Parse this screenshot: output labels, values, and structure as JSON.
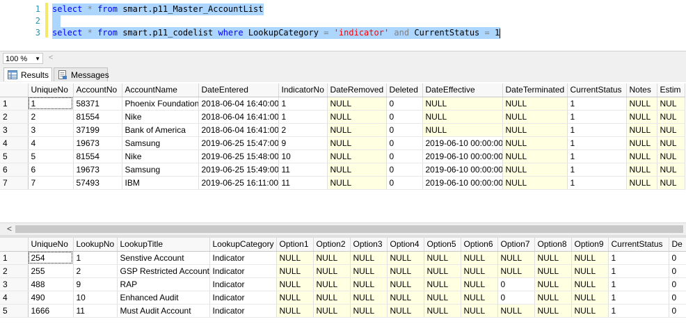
{
  "editor": {
    "lines": [
      {
        "num": "1"
      },
      {
        "num": "2"
      },
      {
        "num": "3"
      }
    ],
    "line1": {
      "kw1": "select",
      "star": "*",
      "kw2": "from",
      "obj": "smart.p11_Master_AccountList"
    },
    "line3": {
      "kw1": "select",
      "star": "*",
      "kw2": "from",
      "obj": "smart.p11_codelist",
      "kw3": "where",
      "col1": "LookupCategory",
      "op1": "=",
      "str": "'indicator'",
      "and": "and",
      "col2": "CurrentStatus",
      "op2": "=",
      "num": "1"
    }
  },
  "zoom": {
    "value": "100 %",
    "scroll_left": "<"
  },
  "tabs": [
    {
      "label": "Results",
      "icon": "grid-icon"
    },
    {
      "label": "Messages",
      "icon": "messages-icon"
    }
  ],
  "grid1": {
    "columns": [
      "",
      "UniqueNo",
      "AccountNo",
      "AccountName",
      "DateEntered",
      "IndicatorNo",
      "DateRemoved",
      "Deleted",
      "DateEffective",
      "DateTerminated",
      "CurrentStatus",
      "Notes",
      "Estim"
    ],
    "rows": [
      [
        "1",
        "1",
        "58371",
        "Phoenix Foundation",
        "2018-06-04 16:40:00",
        "1",
        "NULL",
        "0",
        "NULL",
        "NULL",
        "1",
        "NULL",
        "NUL"
      ],
      [
        "2",
        "2",
        "81554",
        "Nike",
        "2018-06-04 16:41:00",
        "1",
        "NULL",
        "0",
        "NULL",
        "NULL",
        "1",
        "NULL",
        "NUL"
      ],
      [
        "3",
        "3",
        "37199",
        "Bank of America",
        "2018-06-04 16:41:00",
        "2",
        "NULL",
        "0",
        "NULL",
        "NULL",
        "1",
        "NULL",
        "NUL"
      ],
      [
        "4",
        "4",
        "19673",
        "Samsung",
        "2019-06-25 15:47:00",
        "9",
        "NULL",
        "0",
        "2019-06-10 00:00:00",
        "NULL",
        "1",
        "NULL",
        "NUL"
      ],
      [
        "5",
        "5",
        "81554",
        "Nike",
        "2019-06-25 15:48:00",
        "10",
        "NULL",
        "0",
        "2019-06-10 00:00:00",
        "NULL",
        "1",
        "NULL",
        "NUL"
      ],
      [
        "6",
        "6",
        "19673",
        "Samsung",
        "2019-06-25 15:49:00",
        "11",
        "NULL",
        "0",
        "2019-06-10 00:00:00",
        "NULL",
        "1",
        "NULL",
        "NUL"
      ],
      [
        "7",
        "7",
        "57493",
        "IBM",
        "2019-06-25 16:11:00",
        "11",
        "NULL",
        "0",
        "2019-06-10 00:00:00",
        "NULL",
        "1",
        "NULL",
        "NUL"
      ]
    ]
  },
  "grid2": {
    "columns": [
      "",
      "UniqueNo",
      "LookupNo",
      "LookupTitle",
      "LookupCategory",
      "Option1",
      "Option2",
      "Option3",
      "Option4",
      "Option5",
      "Option6",
      "Option7",
      "Option8",
      "Option9",
      "CurrentStatus",
      "De"
    ],
    "rows": [
      [
        "1",
        "254",
        "1",
        "Senstive Account",
        "Indicator",
        "NULL",
        "NULL",
        "NULL",
        "NULL",
        "NULL",
        "NULL",
        "NULL",
        "NULL",
        "NULL",
        "1",
        "0"
      ],
      [
        "2",
        "255",
        "2",
        "GSP Restricted Account",
        "Indicator",
        "NULL",
        "NULL",
        "NULL",
        "NULL",
        "NULL",
        "NULL",
        "NULL",
        "NULL",
        "NULL",
        "1",
        "0"
      ],
      [
        "3",
        "488",
        "9",
        "RAP",
        "Indicator",
        "NULL",
        "NULL",
        "NULL",
        "NULL",
        "NULL",
        "NULL",
        "0",
        "NULL",
        "NULL",
        "1",
        "0"
      ],
      [
        "4",
        "490",
        "10",
        "Enhanced Audit",
        "Indicator",
        "NULL",
        "NULL",
        "NULL",
        "NULL",
        "NULL",
        "NULL",
        "0",
        "NULL",
        "NULL",
        "1",
        "0"
      ],
      [
        "5",
        "1666",
        "11",
        "Must Audit Account",
        "Indicator",
        "NULL",
        "NULL",
        "NULL",
        "NULL",
        "NULL",
        "NULL",
        "NULL",
        "NULL",
        "NULL",
        "1",
        "0"
      ]
    ]
  },
  "scrollbar": {
    "left_arrow": "<"
  }
}
